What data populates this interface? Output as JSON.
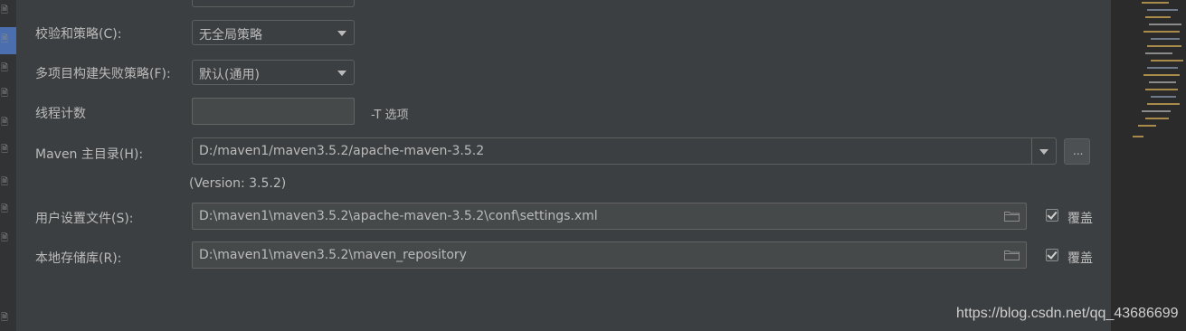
{
  "form": {
    "check_policy": {
      "label": "校验和策略(C):",
      "value": "无全局策略"
    },
    "multiproject_policy": {
      "label": "多项目构建失败策略(F):",
      "value": "默认(通用)"
    },
    "thread_count": {
      "label": "线程计数",
      "value": "",
      "hint": "-T 选项"
    },
    "maven_home": {
      "label": "Maven 主目录(H):",
      "value": "D:/maven1/maven3.5.2/apache-maven-3.5.2",
      "browse_label": "...",
      "version": "(Version: 3.5.2)"
    },
    "user_settings": {
      "label": "用户设置文件(S):",
      "value": "D:\\maven1\\maven3.5.2\\apache-maven-3.5.2\\conf\\settings.xml",
      "override_label": "覆盖",
      "override_checked": true
    },
    "local_repo": {
      "label": "本地存储库(R):",
      "value": "D:\\maven1\\maven3.5.2\\maven_repository",
      "override_label": "覆盖",
      "override_checked": true
    }
  },
  "watermark": "https://blog.csdn.net/qq_43686699",
  "colors": {
    "background": "#3c3f41",
    "selection": "#4b6eaf",
    "text": "#bbbbbb"
  },
  "icons": {
    "gutter": "file-icon",
    "browse": "folder-icon",
    "dropdown": "chevron-down-icon",
    "check": "checkmark-icon"
  }
}
